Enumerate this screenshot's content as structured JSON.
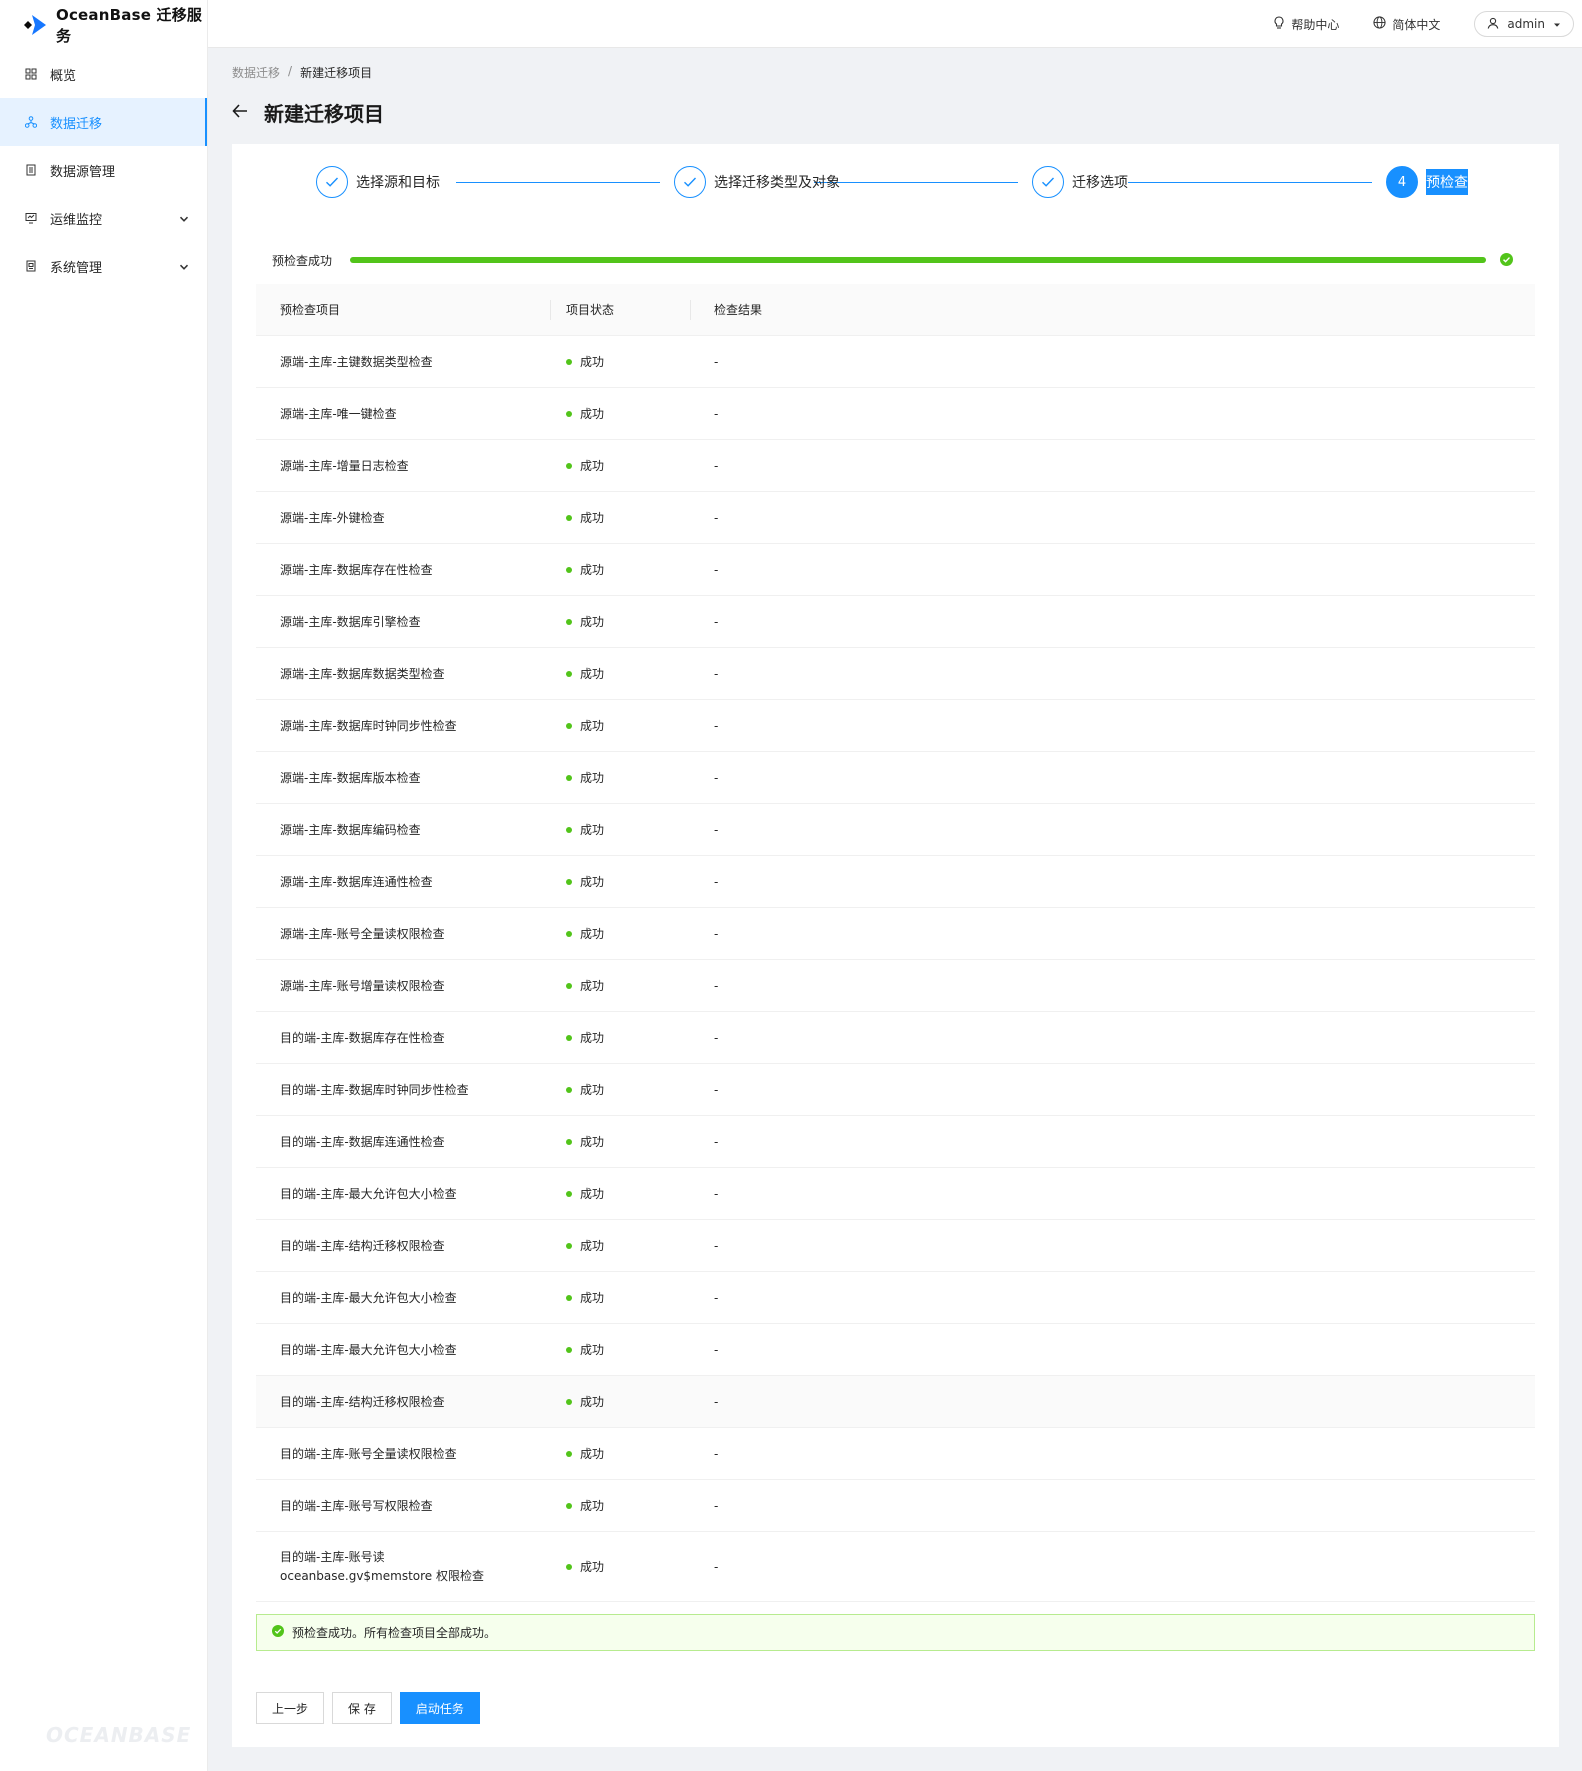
{
  "app": {
    "logo_text": "OceanBase 迁移服务",
    "watermark": "OCEANBASE"
  },
  "sidebar": {
    "items": [
      {
        "label": "概览",
        "icon": "grid-icon",
        "active": false,
        "expandable": false
      },
      {
        "label": "数据迁移",
        "icon": "migration-icon",
        "active": true,
        "expandable": false
      },
      {
        "label": "数据源管理",
        "icon": "datasource-icon",
        "active": false,
        "expandable": false
      },
      {
        "label": "运维监控",
        "icon": "monitor-icon",
        "active": false,
        "expandable": true
      },
      {
        "label": "系统管理",
        "icon": "settings-doc-icon",
        "active": false,
        "expandable": true
      }
    ]
  },
  "header": {
    "help_label": "帮助中心",
    "language_label": "简体中文",
    "user_label": "admin"
  },
  "breadcrumb": {
    "parent": "数据迁移",
    "separator": "/",
    "current": "新建迁移项目"
  },
  "page": {
    "title": "新建迁移项目"
  },
  "steps": [
    {
      "label": "选择源和目标",
      "state": "done"
    },
    {
      "label": "选择迁移类型及对象",
      "state": "done"
    },
    {
      "label": "迁移选项",
      "state": "done"
    },
    {
      "label": "预检查",
      "state": "active",
      "number": "4"
    }
  ],
  "progress": {
    "label": "预检查成功",
    "value_percent": 100,
    "color": "#52c41a"
  },
  "table": {
    "columns": [
      "预检查项目",
      "项目状态",
      "检查结果"
    ],
    "rows": [
      {
        "item": "源端-主库-主键数据类型检查",
        "status": "成功",
        "result": "-"
      },
      {
        "item": "源端-主库-唯一键检查",
        "status": "成功",
        "result": "-"
      },
      {
        "item": "源端-主库-增量日志检查",
        "status": "成功",
        "result": "-"
      },
      {
        "item": "源端-主库-外键检查",
        "status": "成功",
        "result": "-"
      },
      {
        "item": "源端-主库-数据库存在性检查",
        "status": "成功",
        "result": "-"
      },
      {
        "item": "源端-主库-数据库引擎检查",
        "status": "成功",
        "result": "-"
      },
      {
        "item": "源端-主库-数据库数据类型检查",
        "status": "成功",
        "result": "-"
      },
      {
        "item": "源端-主库-数据库时钟同步性检查",
        "status": "成功",
        "result": "-"
      },
      {
        "item": "源端-主库-数据库版本检查",
        "status": "成功",
        "result": "-"
      },
      {
        "item": "源端-主库-数据库编码检查",
        "status": "成功",
        "result": "-"
      },
      {
        "item": "源端-主库-数据库连通性检查",
        "status": "成功",
        "result": "-"
      },
      {
        "item": "源端-主库-账号全量读权限检查",
        "status": "成功",
        "result": "-"
      },
      {
        "item": "源端-主库-账号增量读权限检查",
        "status": "成功",
        "result": "-"
      },
      {
        "item": "目的端-主库-数据库存在性检查",
        "status": "成功",
        "result": "-"
      },
      {
        "item": "目的端-主库-数据库时钟同步性检查",
        "status": "成功",
        "result": "-"
      },
      {
        "item": "目的端-主库-数据库连通性检查",
        "status": "成功",
        "result": "-"
      },
      {
        "item": "目的端-主库-最大允许包大小检查",
        "status": "成功",
        "result": "-"
      },
      {
        "item": "目的端-主库-结构迁移权限检查",
        "status": "成功",
        "result": "-"
      },
      {
        "item": "目的端-主库-最大允许包大小检查",
        "status": "成功",
        "result": "-"
      },
      {
        "item": "目的端-主库-最大允许包大小检查",
        "status": "成功",
        "result": "-"
      },
      {
        "item": "目的端-主库-结构迁移权限检查",
        "status": "成功",
        "result": "-",
        "highlighted": true
      },
      {
        "item": "目的端-主库-账号全量读权限检查",
        "status": "成功",
        "result": "-"
      },
      {
        "item": "目的端-主库-账号写权限检查",
        "status": "成功",
        "result": "-"
      },
      {
        "item": "目的端-主库-账号读 oceanbase.gv$memstore 权限检查",
        "status": "成功",
        "result": "-",
        "tall": true
      }
    ]
  },
  "alert": {
    "text": "预检查成功。所有检查项目全部成功。"
  },
  "buttons": {
    "prev": "上一步",
    "save": "保 存",
    "start": "启动任务"
  },
  "colors": {
    "primary": "#1890ff",
    "success": "#52c41a"
  }
}
